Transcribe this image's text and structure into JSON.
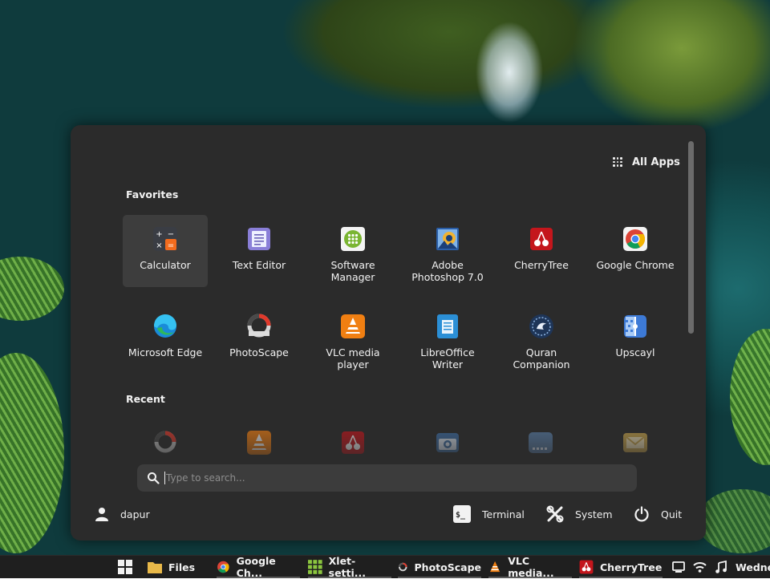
{
  "menu": {
    "all_apps_label": "All Apps",
    "favorites_heading": "Favorites",
    "recent_heading": "Recent",
    "favorites": [
      {
        "label": "Calculator",
        "icon": "calculator-icon"
      },
      {
        "label": "Text Editor",
        "icon": "text-editor-icon"
      },
      {
        "label": "Software Manager",
        "icon": "software-manager-icon"
      },
      {
        "label": "Adobe Photoshop 7.0",
        "icon": "photoshop-icon"
      },
      {
        "label": "CherryTree",
        "icon": "cherrytree-icon"
      },
      {
        "label": "Google Chrome",
        "icon": "chrome-icon"
      },
      {
        "label": "Microsoft Edge",
        "icon": "edge-icon"
      },
      {
        "label": "PhotoScape",
        "icon": "photoscape-icon"
      },
      {
        "label": "VLC media player",
        "icon": "vlc-icon"
      },
      {
        "label": "LibreOffice Writer",
        "icon": "libreoffice-writer-icon"
      },
      {
        "label": "Quran Companion",
        "icon": "quran-companion-icon"
      },
      {
        "label": "Upscayl",
        "icon": "upscayl-icon"
      }
    ],
    "recent": [
      {
        "icon": "photoscape-icon"
      },
      {
        "icon": "vlc-icon"
      },
      {
        "icon": "cherrytree-icon"
      },
      {
        "icon": "camera-icon"
      },
      {
        "icon": "keyboard-icon"
      },
      {
        "icon": "mail-icon"
      }
    ],
    "search": {
      "placeholder": "Type to search..."
    },
    "user": {
      "name": "dapur",
      "icon": "user-icon"
    },
    "terminal_label": "Terminal",
    "system_label": "System",
    "quit_label": "Quit"
  },
  "taskbar": {
    "items": [
      {
        "label": "Files",
        "icon": "folder-icon"
      },
      {
        "label": "Google Ch...",
        "icon": "chrome-icon"
      },
      {
        "label": "Xlet-setti...",
        "icon": "xlet-settings-icon"
      },
      {
        "label": "PhotoScape",
        "icon": "photoscape-icon"
      },
      {
        "label": "VLC media...",
        "icon": "vlc-icon"
      },
      {
        "label": "CherryTree",
        "icon": "cherrytree-icon"
      }
    ],
    "clock": "Wedne",
    "tray_icons": [
      "display-icon",
      "wifi-icon",
      "music-icon",
      "volume-icon"
    ]
  },
  "colors": {
    "panel": "#2b2b2b",
    "selected": "#3d3d3d",
    "search": "#3c3c3c",
    "taskbar": "#1f1f1f"
  }
}
